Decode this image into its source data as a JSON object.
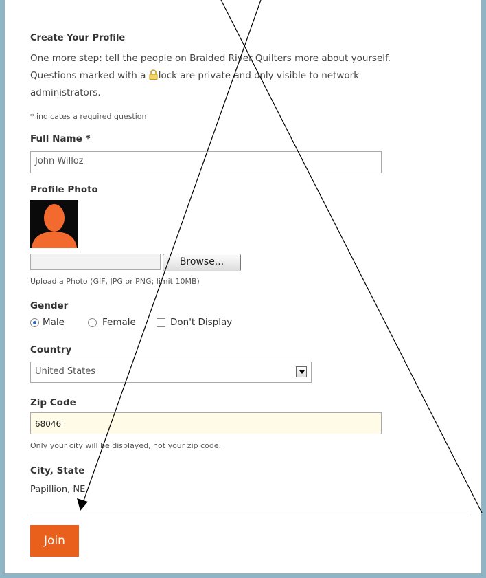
{
  "form": {
    "title": "Create Your Profile",
    "intro_line1": "One more step: tell the people on Braided River Quilters more about yourself.",
    "intro_line2_before": "Questions marked with a ",
    "intro_line2_after": "lock are private and only visible to network",
    "intro_line3": "administrators.",
    "required_note": "* indicates a required question",
    "full_name_label": "Full Name *",
    "full_name_value": "John Willoz",
    "photo_label": "Profile Photo",
    "browse_label": "Browse...",
    "upload_hint": "Upload a Photo (GIF, JPG or PNG; limit 10MB)",
    "gender_label": "Gender",
    "gender_options": [
      "Male",
      "Female",
      "Don't Display"
    ],
    "gender_selected": "Male",
    "country_label": "Country",
    "country_value": "United States",
    "zip_label": "Zip Code",
    "zip_value": "68046",
    "zip_hint": "Only your city will be displayed, not your zip code.",
    "city_label": "City, State",
    "city_value": "Papillion, NE",
    "join_label": "Join"
  },
  "colors": {
    "frame": "#8fb4c4",
    "join_button": "#e8601c",
    "lock_icon": "#d9b23a",
    "avatar_silhouette": "#f26a2e"
  },
  "icons": {
    "lock": "lock-icon",
    "avatar": "person-silhouette-icon",
    "dropdown": "chevron-down-icon"
  }
}
